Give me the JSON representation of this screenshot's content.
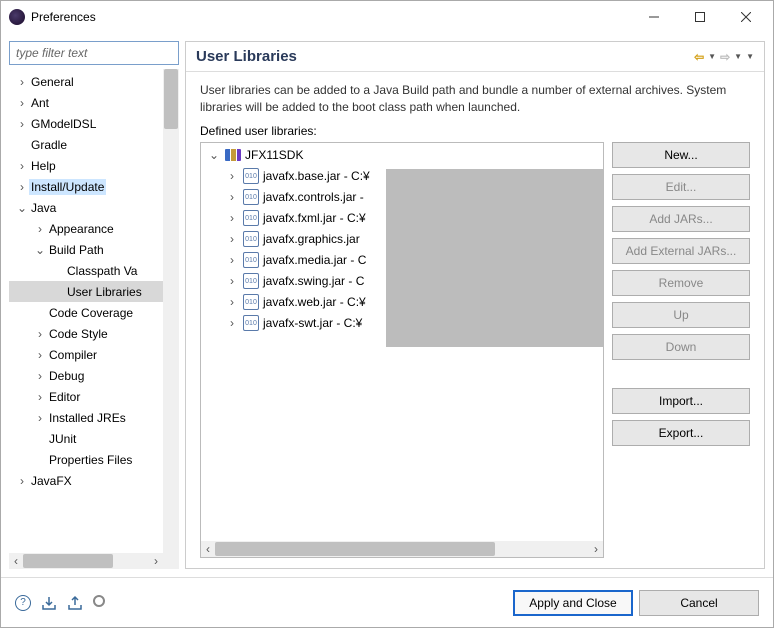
{
  "window": {
    "title": "Preferences"
  },
  "filter": {
    "placeholder": "type filter text"
  },
  "tree": [
    {
      "label": "General",
      "depth": 0,
      "tw": "›"
    },
    {
      "label": "Ant",
      "depth": 0,
      "tw": "›"
    },
    {
      "label": "GModelDSL",
      "depth": 0,
      "tw": "›"
    },
    {
      "label": "Gradle",
      "depth": 0,
      "tw": ""
    },
    {
      "label": "Help",
      "depth": 0,
      "tw": "›"
    },
    {
      "label": "Install/Update",
      "depth": 0,
      "tw": "›",
      "cls": "ti-inst"
    },
    {
      "label": "Java",
      "depth": 0,
      "tw": "⌄"
    },
    {
      "label": "Appearance",
      "depth": 1,
      "tw": "›"
    },
    {
      "label": "Build Path",
      "depth": 1,
      "tw": "⌄"
    },
    {
      "label": "Classpath Va",
      "depth": 2,
      "tw": ""
    },
    {
      "label": "User Libraries",
      "depth": 2,
      "tw": "",
      "cls": "ti-ul"
    },
    {
      "label": "Code Coverage",
      "depth": 1,
      "tw": ""
    },
    {
      "label": "Code Style",
      "depth": 1,
      "tw": "›"
    },
    {
      "label": "Compiler",
      "depth": 1,
      "tw": "›"
    },
    {
      "label": "Debug",
      "depth": 1,
      "tw": "›"
    },
    {
      "label": "Editor",
      "depth": 1,
      "tw": "›"
    },
    {
      "label": "Installed JREs",
      "depth": 1,
      "tw": "›"
    },
    {
      "label": "JUnit",
      "depth": 1,
      "tw": ""
    },
    {
      "label": "Properties Files",
      "depth": 1,
      "tw": ""
    },
    {
      "label": "JavaFX",
      "depth": 0,
      "tw": "›"
    }
  ],
  "page": {
    "title": "User Libraries",
    "desc": "User libraries can be added to a Java Build path and bundle a number of external archives. System libraries will be added to the boot class path when launched.",
    "deflabel": "Defined user libraries:"
  },
  "lib": {
    "root": {
      "name": "JFX11SDK",
      "tw": "⌄"
    },
    "jars": [
      {
        "label": "javafx.base.jar - C:¥",
        "tw": "›"
      },
      {
        "label": "javafx.controls.jar -",
        "tw": "›"
      },
      {
        "label": "javafx.fxml.jar - C:¥",
        "tw": "›"
      },
      {
        "label": "javafx.graphics.jar",
        "tw": "›"
      },
      {
        "label": "javafx.media.jar - C",
        "tw": "›"
      },
      {
        "label": "javafx.swing.jar - C",
        "tw": "›"
      },
      {
        "label": "javafx.web.jar - C:¥",
        "tw": "›"
      },
      {
        "label": "javafx-swt.jar - C:¥",
        "tw": "›"
      }
    ]
  },
  "buttons": {
    "new": "New...",
    "edit": "Edit...",
    "addjars": "Add JARs...",
    "addext": "Add External JARs...",
    "remove": "Remove",
    "up": "Up",
    "down": "Down",
    "import": "Import...",
    "export": "Export...",
    "apply": "Apply and Close",
    "cancel": "Cancel"
  }
}
